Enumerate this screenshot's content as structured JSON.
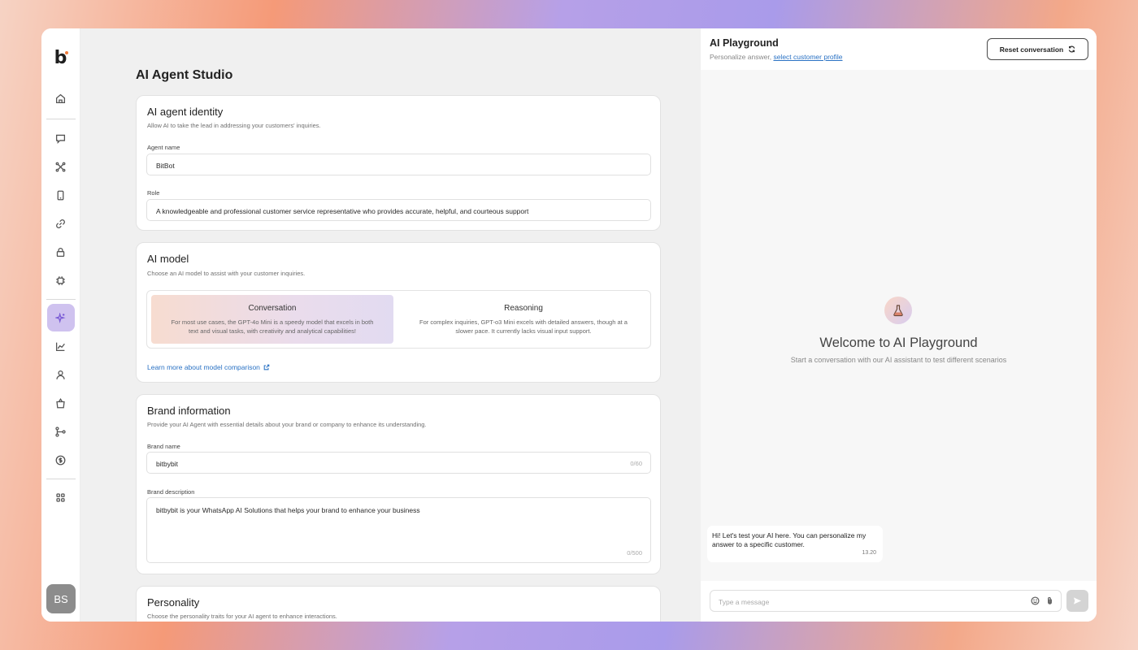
{
  "sidebar": {
    "logo": "b",
    "avatar_initials": "BS",
    "active_color": "#cfc2ef",
    "icons": [
      "home-icon",
      "chat-icon",
      "network-icon",
      "mobile-icon",
      "link-icon",
      "lock-icon",
      "chip-icon",
      "sparkle-icon",
      "chart-icon",
      "user-icon",
      "bag-icon",
      "flow-icon",
      "dollar-icon",
      "apps-icon"
    ],
    "active_item": "sparkle-icon"
  },
  "main": {
    "page_title": "AI Agent Studio",
    "identity": {
      "title": "AI agent identity",
      "desc": "Allow AI to take the lead in addressing your customers' inquiries.",
      "agent_name_label": "Agent name",
      "agent_name_value": "BitBot",
      "role_label": "Role",
      "role_value": "A knowledgeable and professional customer service representative who provides accurate, helpful, and courteous support"
    },
    "model": {
      "title": "AI model",
      "desc": "Choose an AI model to assist with your customer inquiries.",
      "options": [
        {
          "title": "Conversation",
          "desc": "For most use cases, the GPT-4o Mini is a speedy model that excels in both text and visual tasks, with creativity and analytical capabilities!",
          "selected": true
        },
        {
          "title": "Reasoning",
          "desc": "For complex inquiries, GPT-o3 Mini excels with detailed answers, though at a slower pace. It currently lacks visual input support.",
          "selected": false
        }
      ],
      "link": "Learn more about model comparison"
    },
    "brand": {
      "title": "Brand information",
      "desc": "Provide your AI Agent with essential details about your brand or company to enhance its understanding.",
      "name_label": "Brand name",
      "name_value": "bitbybit",
      "name_counter": "0/60",
      "description_label": "Brand description",
      "description_value": "bitbybit is your WhatsApp AI Solutions that helps your brand to enhance your business",
      "description_counter": "0/500"
    },
    "personality": {
      "title": "Personality",
      "desc": "Choose the personality traits for your AI agent to enhance interactions."
    }
  },
  "playground": {
    "title": "AI Playground",
    "subtitle_prefix": "Personalize answer,",
    "subtitle_link": "select customer profile",
    "reset_label": "Reset conversation",
    "welcome_title": "Welcome to AI Playground",
    "welcome_sub": "Start a conversation with our AI assistant to test different scenarios",
    "message": {
      "text": "Hi! Let's test your AI here. You can personalize my answer to a specific customer.",
      "time": "13.20"
    },
    "composer_placeholder": "Type a message"
  }
}
